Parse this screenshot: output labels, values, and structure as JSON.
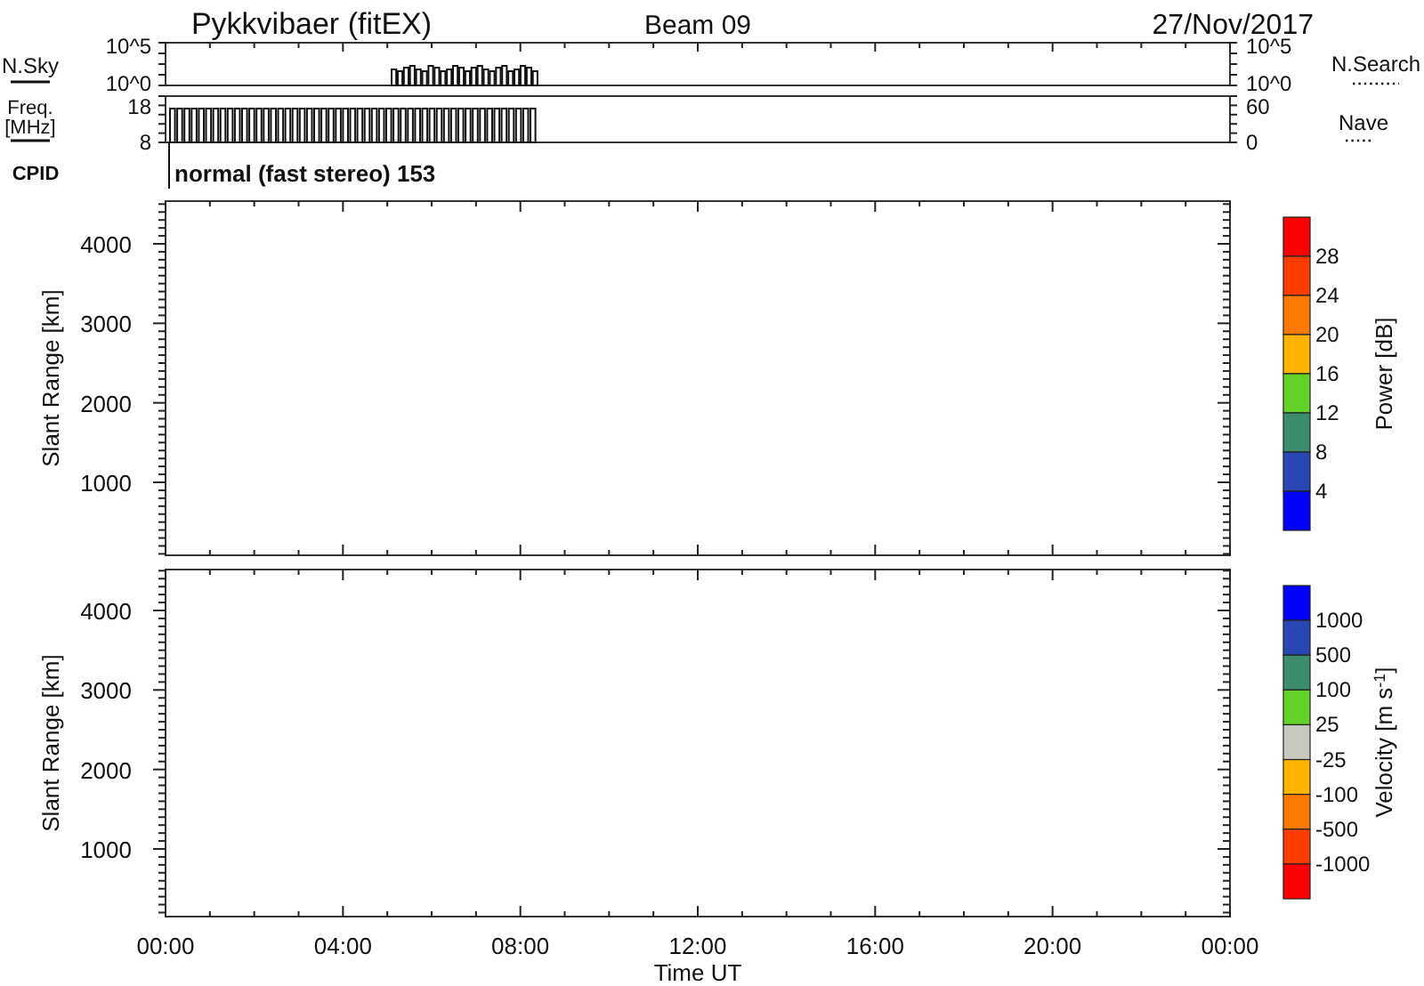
{
  "title": {
    "station": "Pykkvibaer (fitEX)",
    "beam": "Beam 09",
    "date": "27/Nov/2017"
  },
  "nsky": {
    "label": "N.Sky",
    "left_ticks": [
      "10^5",
      "10^0"
    ],
    "right_ticks": [
      "10^5",
      "10^0"
    ],
    "right_label": "N.Search"
  },
  "freq": {
    "label": "Freq.",
    "unit": "[MHz]",
    "left_ticks": [
      "18",
      "8"
    ],
    "right_ticks": [
      "60",
      "0"
    ],
    "right_label": "Nave"
  },
  "cpid": {
    "label": "CPID",
    "value": "normal (fast stereo) 153"
  },
  "panels": [
    {
      "ylabel": "Slant Range [km]",
      "yticks": [
        "4000",
        "3000",
        "2000",
        "1000"
      ],
      "colorbar": {
        "title": "Power [dB]",
        "segments": [
          {
            "color": "#ff0000"
          },
          {
            "color": "#ff3c00"
          },
          {
            "color": "#ff7800"
          },
          {
            "color": "#ffb400"
          },
          {
            "color": "#64d228"
          },
          {
            "color": "#3c8c6e"
          },
          {
            "color": "#2846b4"
          },
          {
            "color": "#0000ff"
          }
        ],
        "labels": [
          "28",
          "24",
          "20",
          "16",
          "12",
          "8",
          "4"
        ]
      }
    },
    {
      "ylabel": "Slant Range [km]",
      "yticks": [
        "4000",
        "3000",
        "2000",
        "1000"
      ],
      "colorbar": {
        "title": "Velocity [m s$^{-1}$]",
        "segments": [
          {
            "color": "#0000ff"
          },
          {
            "color": "#2846b4"
          },
          {
            "color": "#3c8c6e"
          },
          {
            "color": "#64d228"
          },
          {
            "color": "#c8c8be"
          },
          {
            "color": "#ffb400"
          },
          {
            "color": "#ff7800"
          },
          {
            "color": "#ff3c00"
          },
          {
            "color": "#ff0000"
          }
        ],
        "labels": [
          "1000",
          "500",
          "100",
          "25",
          "-25",
          "-100",
          "-500",
          "-1000"
        ]
      }
    }
  ],
  "xticks": [
    "00:00",
    "04:00",
    "08:00",
    "12:00",
    "16:00",
    "20:00",
    "00:00"
  ],
  "xlabel": "Time UT"
}
